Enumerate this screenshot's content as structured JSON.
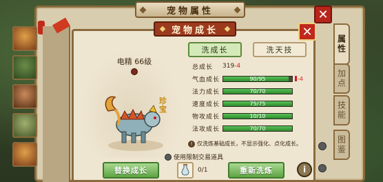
{
  "window": {
    "title": "宠物属性"
  },
  "dialog": {
    "title": "宠物成长"
  },
  "pet": {
    "name_level": "电精 66级",
    "badge": "珍宝"
  },
  "actions": {
    "tab_wash_growth": "洗成长",
    "tab_wash_skill": "洗天技"
  },
  "total_growth": {
    "label": "总成长",
    "value": "319",
    "delta": "-4"
  },
  "growth_stats": [
    {
      "label": "气血成长",
      "value_text": "90/95",
      "current": 90,
      "max": 95,
      "extra": "-4"
    },
    {
      "label": "法力成长",
      "value_text": "70/70",
      "current": 70,
      "max": 70
    },
    {
      "label": "速度成长",
      "value_text": "75/75",
      "current": 75,
      "max": 75
    },
    {
      "label": "物攻成长",
      "value_text": "10/10",
      "current": 10,
      "max": 10
    },
    {
      "label": "法攻成长",
      "value_text": "70/70",
      "current": 70,
      "max": 70
    }
  ],
  "notice": {
    "text": "仅洗炼基础成长，不显示强化、点化成长。"
  },
  "restricted": {
    "label": "使用限制交易道具"
  },
  "buttons": {
    "replace_growth": "替换成长",
    "rewash": "重新洗炼"
  },
  "item": {
    "count": "0/1"
  },
  "side_tabs": [
    "属性",
    "加点",
    "技能",
    "图鉴"
  ],
  "colors": {
    "bar_fill": "#3aa23a",
    "close_red": "#c0281b",
    "dialog_title": "#9c3a1e",
    "negative": "#d21e1e"
  }
}
